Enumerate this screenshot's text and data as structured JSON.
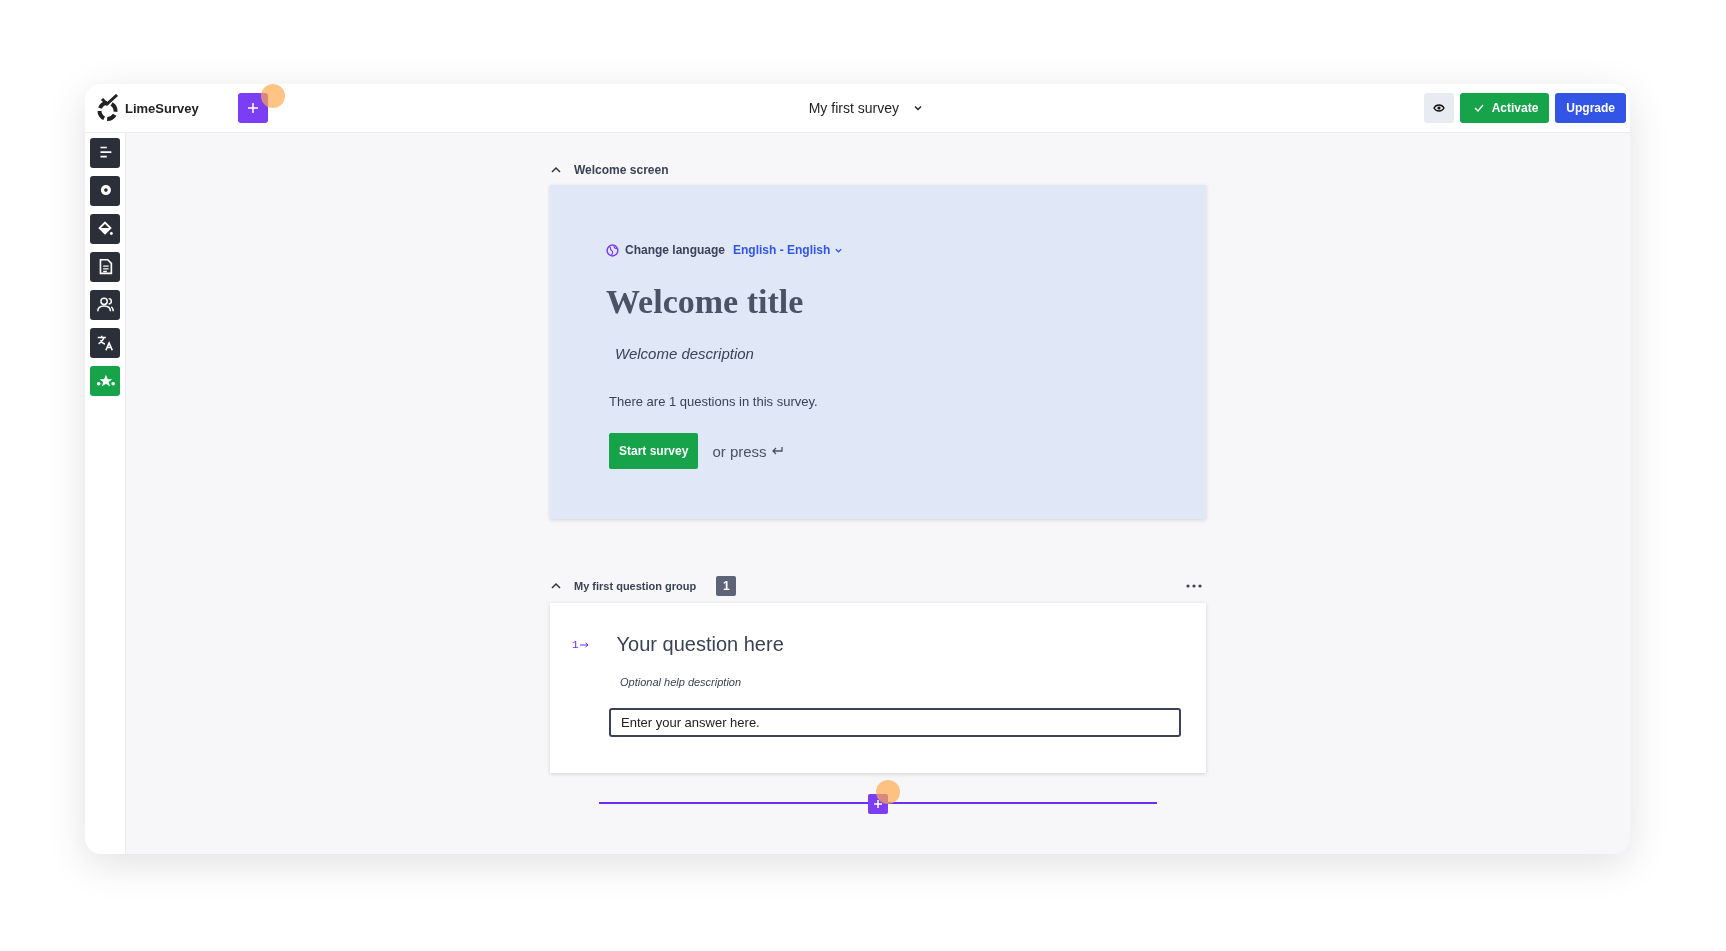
{
  "topbar": {
    "logo": "LimeSurvey",
    "survey_title": "My first survey",
    "buttons": [
      {
        "kind": "preview"
      },
      {
        "kind": "activate",
        "label": "Activate"
      },
      {
        "kind": "upgrade",
        "label": "Upgrade"
      }
    ]
  },
  "sidebar": {
    "items": [
      {
        "kind": "structure",
        "selected": false
      },
      {
        "kind": "settings",
        "selected": false
      },
      {
        "kind": "theme",
        "selected": false
      },
      {
        "kind": "document",
        "selected": false
      },
      {
        "kind": "participants",
        "selected": false
      },
      {
        "kind": "translate",
        "selected": false
      },
      {
        "kind": "stars",
        "selected": true
      }
    ]
  },
  "welcome": {
    "section_title": "Welcome screen",
    "expanded": true,
    "language_label": "Change language",
    "language": "English - English",
    "title": "Welcome title",
    "description": "Welcome description",
    "info": "There are 1 questions in this survey.",
    "start_button": "Start survey",
    "hint": "or press"
  },
  "group": {
    "title": "My first question group",
    "expanded": true,
    "count": "1",
    "questions": [
      {
        "number": "1",
        "text": "Your question here",
        "help": "Optional help description",
        "placeholder": "Enter your answer here."
      }
    ]
  }
}
